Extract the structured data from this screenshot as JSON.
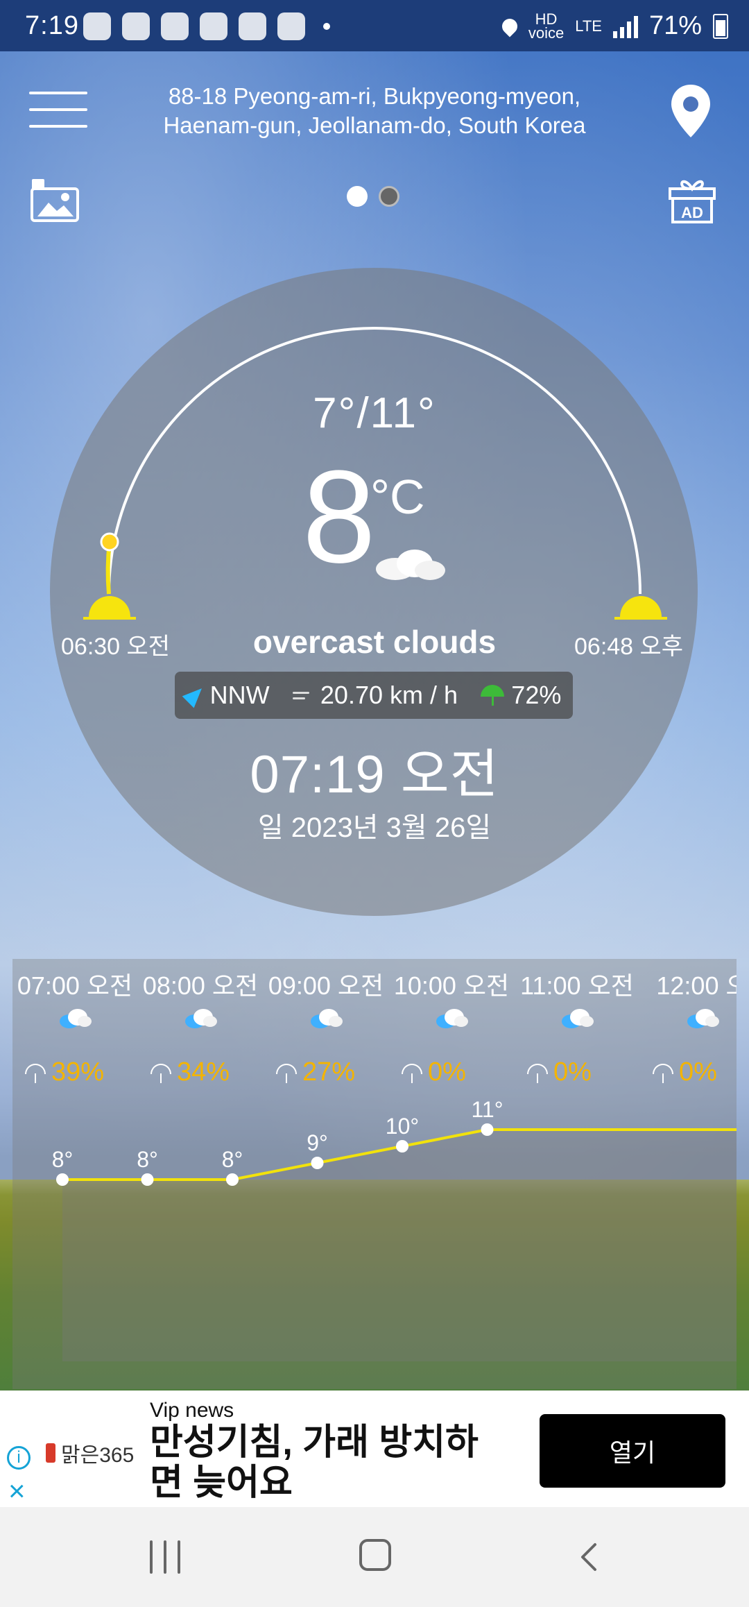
{
  "status_bar": {
    "time": "7:19",
    "network_label_top": "HD",
    "network_label_bottom": "voice",
    "lte": "LTE",
    "battery": "71%"
  },
  "header": {
    "address_line1": "88-18 Pyeong-am-ri, Bukpyeong-myeon,",
    "address_line2": "Haenam-gun, Jeollanam-do, South Korea",
    "ad_label": "AD"
  },
  "weather": {
    "minmax": "7°/11°",
    "current_temp": "8",
    "unit": "°C",
    "condition": "overcast clouds",
    "sunrise": "06:30 오전",
    "sunset": "06:48 오후",
    "wind_direction": "NNW",
    "wind_speed": "20.70 km / h",
    "humidity": "72%",
    "time_now": "07:19 오전",
    "date_now": "일 2023년 3월 26일"
  },
  "forecast": {
    "hours": [
      {
        "time": "07:00 오전",
        "precip": "39%",
        "temp": "8°"
      },
      {
        "time": "08:00 오전",
        "precip": "34%",
        "temp": "8°"
      },
      {
        "time": "09:00 오전",
        "precip": "27%",
        "temp": "8°"
      },
      {
        "time": "10:00 오전",
        "precip": "0%",
        "temp": "9°"
      },
      {
        "time": "11:00 오전",
        "precip": "0%",
        "temp": "10°"
      },
      {
        "time": "12:00 오",
        "precip": "0%",
        "temp": "11°"
      }
    ]
  },
  "chart_data": {
    "type": "line",
    "categories": [
      "07:00 오전",
      "08:00 오전",
      "09:00 오전",
      "10:00 오전",
      "11:00 오전",
      "12:00 오"
    ],
    "values": [
      8,
      8,
      8,
      9,
      10,
      11
    ],
    "ylim": [
      8,
      11
    ],
    "line_color": "#f2e20b"
  },
  "ad": {
    "source": "Vip news",
    "headline": "만성기침, 가래 방치하면 늦어요",
    "brand": "맑은365",
    "cta": "열기",
    "info_glyph": "i",
    "close_glyph": "×"
  },
  "colors": {
    "accent_blue": "#23b9ff",
    "precip_orange": "#f4b400",
    "umbrella_green": "#3dbb39"
  }
}
